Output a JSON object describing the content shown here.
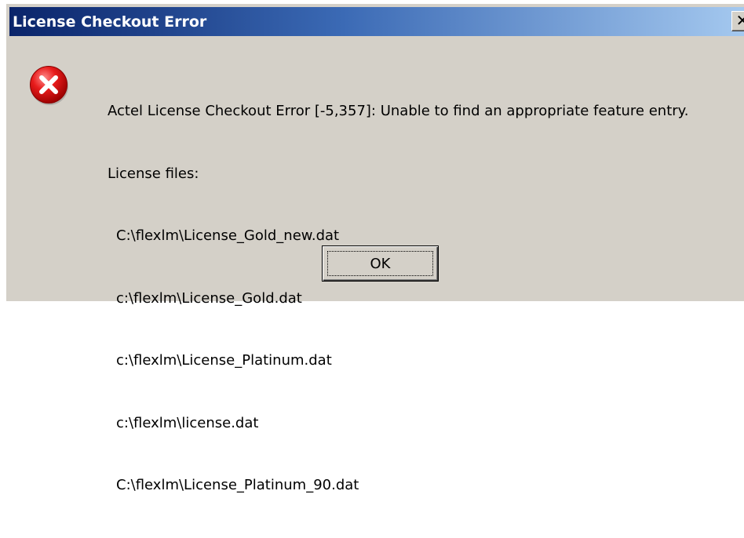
{
  "window": {
    "title": "License Checkout Error",
    "close_glyph": "✕",
    "close_icon": "close-icon"
  },
  "message": {
    "icon": "error-icon",
    "icon_color": "#e01a1a",
    "headline": "Actel License Checkout Error [-5,357]: Unable to find an appropriate feature entry.",
    "files_label": "License files:",
    "files": [
      "C:\\flexlm\\License_Gold_new.dat",
      "c:\\flexlm\\License_Gold.dat",
      "c:\\flexlm\\License_Platinum.dat",
      "c:\\flexlm\\license.dat",
      "C:\\flexlm\\License_Platinum_90.dat"
    ]
  },
  "buttons": {
    "ok_label": "OK"
  },
  "colors": {
    "titlebar_start": "#0a246a",
    "titlebar_end": "#a6caf0",
    "dialog_bg": "#d4d0c8"
  }
}
